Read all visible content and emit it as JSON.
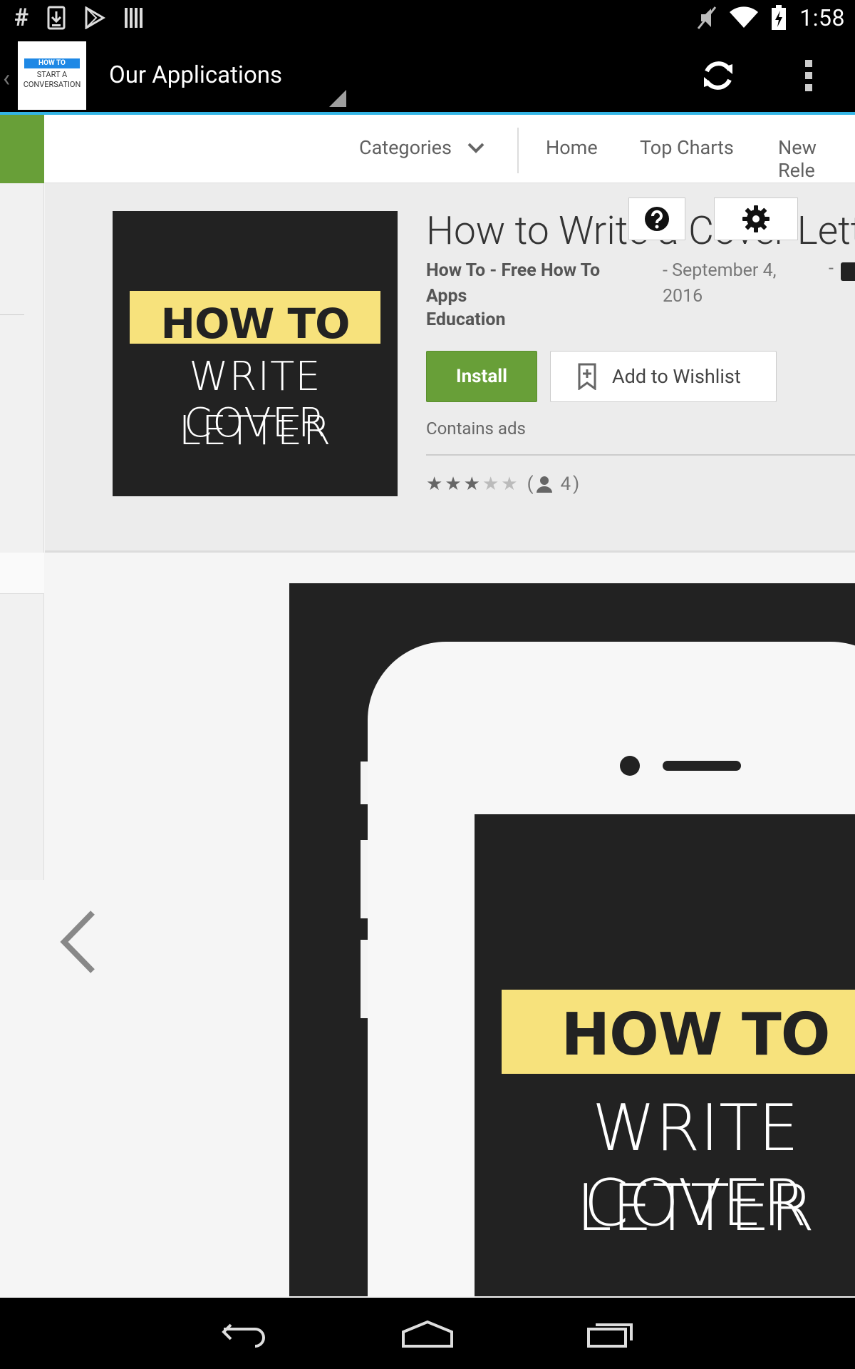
{
  "status_bar": {
    "time": "1:58",
    "left_icons": [
      "hash-icon",
      "download-icon",
      "play-store-icon",
      "barcode-icon"
    ],
    "right_icons": [
      "mute-icon",
      "wifi-icon",
      "battery-charging-icon"
    ]
  },
  "action_bar": {
    "logo": {
      "line1": "HOW TO",
      "line2": "START A",
      "line3": "CONVERSATION"
    },
    "title": "Our Applications"
  },
  "nav": {
    "categories_label": "Categories",
    "items": [
      "Home",
      "Top Charts",
      "New Rele"
    ]
  },
  "app": {
    "icon_text": {
      "line1": "HOW TO",
      "line2": "WRITE COVER",
      "line3": "LETTER"
    },
    "title": "How to Write a Cover Letter",
    "developer": "How To - Free How To Apps",
    "category": "Education",
    "date": "- September 4, 2016",
    "dash": "-",
    "install_label": "Install",
    "wishlist_label": "Add to Wishlist",
    "contains_ads": "Contains ads",
    "rating": {
      "stars": 3,
      "max": 5,
      "count": "4",
      "paren_open": "(",
      "paren_close": ")"
    }
  },
  "screenshot": {
    "text": {
      "line1": "HOW TO",
      "line2": "WRITE COVER",
      "line3": "LETTER"
    }
  },
  "colors": {
    "accent_green": "#689f38",
    "actionbar_underline": "#33b5e5",
    "icon_yellow": "#f7e27c"
  }
}
